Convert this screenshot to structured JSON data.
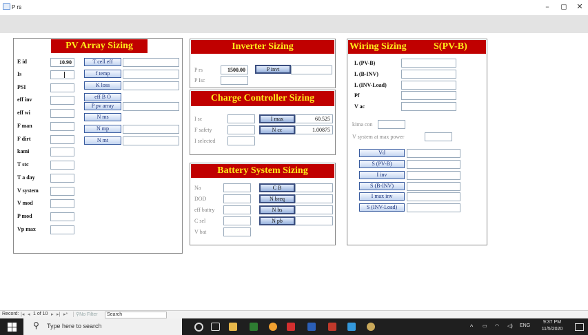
{
  "window": {
    "title": "P rs",
    "minimize": "–",
    "maximize": "◻",
    "close": "✕"
  },
  "pv_array": {
    "title": "PV Array Sizing",
    "labels": [
      "E id",
      "Is",
      "PSI",
      "eff inv",
      "eff wi",
      "F man",
      "F dirt",
      "kami",
      "T stc",
      "T a day",
      "V system",
      "V mod",
      "P mod",
      "Vp max"
    ],
    "e_id_value": "10.90",
    "buttons": [
      "T cell eff",
      "f temp",
      "K loss",
      "eff B O",
      "P pv array",
      "N ms",
      "N mp",
      "N mt"
    ]
  },
  "inverter": {
    "title": "Inverter Sizing",
    "labels": [
      "P rs",
      "P Isc"
    ],
    "p_rs_value": "1500.00",
    "button": "P invt"
  },
  "charge_controller": {
    "title": "Charge Controller Sizing",
    "labels": [
      "I sc",
      "F safety",
      "I selected"
    ],
    "buttons": [
      "I max",
      "N cc"
    ],
    "i_max_value": "60.525",
    "n_cc_value": "1.00875"
  },
  "battery": {
    "title": "Battery System Sizing",
    "labels": [
      "Na",
      "DOD",
      "eff battry",
      "C sel",
      "V bat"
    ],
    "buttons": [
      "C B",
      "N breq",
      "N bs",
      "N pb"
    ]
  },
  "wiring": {
    "title": "Wiring Sizing",
    "title_right": "S(PV-B)",
    "labels": [
      "L (PV-B)",
      "L (B-INV)",
      "L (INV-Load)",
      "Pf",
      "V ac"
    ],
    "kima_con": "kima con",
    "v_system_max": "V system at max power",
    "buttons": [
      "Vd",
      "S (PV-B)",
      "I inv",
      "S (B-INV)",
      "I max inv",
      "S (INV-Load)"
    ]
  },
  "record_nav": {
    "record_label": "Record:",
    "position": "1 of 10",
    "filter": "No Filter",
    "search": "Search"
  },
  "taskbar": {
    "search_placeholder": "Type here to search",
    "language": "ENG",
    "time": "9:37 PM",
    "date": "11/5/2020"
  },
  "colors": {
    "section_title_bg": "#c00000",
    "section_title_fg": "#ffe81a",
    "button_border": "#3a5da0"
  }
}
